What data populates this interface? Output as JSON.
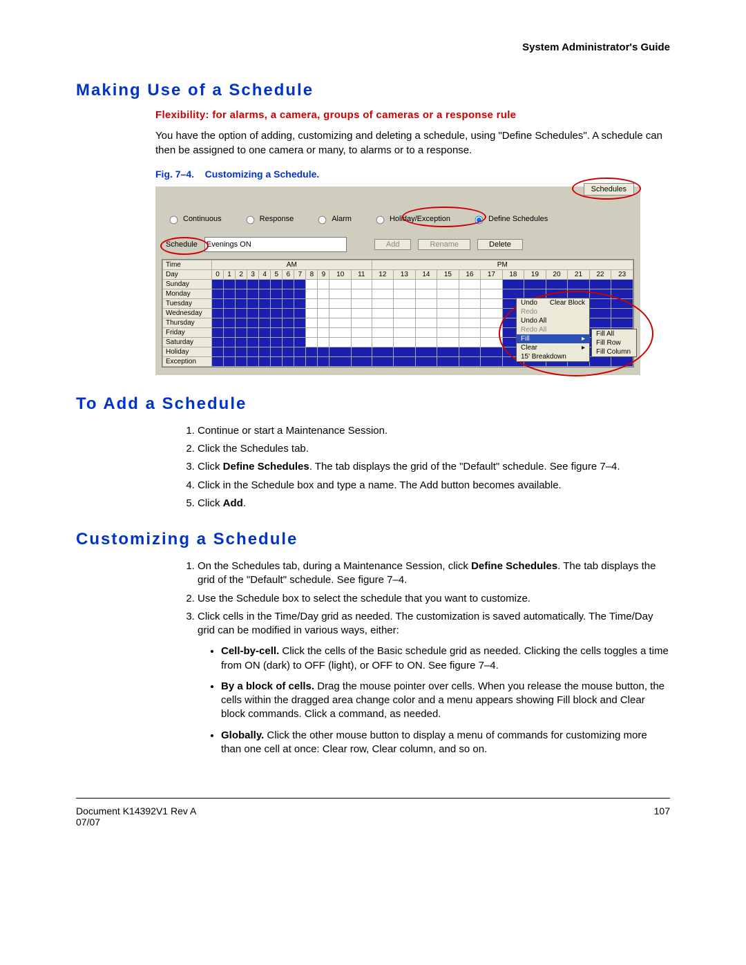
{
  "header": {
    "right": "System Administrator's Guide"
  },
  "h1_making": "Making Use of a Schedule",
  "red_sub": "Flexibility: for alarms, a camera, groups of cameras or a response rule",
  "para_intro": "You have the option of adding, customizing and deleting a schedule, using \"Define Schedules\". A schedule can then be assigned to one  camera or many, to alarms or to a response.",
  "fig_caption_prefix": "Fig. 7–4.",
  "fig_caption_title": "Customizing a Schedule.",
  "fig": {
    "schedules_tab": "Schedules",
    "radios": {
      "continuous": "Continuous",
      "response": "Response",
      "alarm": "Alarm",
      "holiday": "Holiday/Exception",
      "define": "Define Schedules"
    },
    "schedule_label": "Schedule",
    "schedule_value": "Evenings ON",
    "btn_add": "Add",
    "btn_rename": "Rename",
    "btn_delete": "Delete",
    "grid": {
      "time_label": "Time",
      "day_label": "Day",
      "am_label": "AM",
      "pm_label": "PM",
      "hours": [
        "0",
        "1",
        "2",
        "3",
        "4",
        "5",
        "6",
        "7",
        "8",
        "9",
        "10",
        "11",
        "12",
        "13",
        "14",
        "15",
        "16",
        "17",
        "18",
        "19",
        "20",
        "21",
        "22",
        "23"
      ],
      "days": [
        "Sunday",
        "Monday",
        "Tuesday",
        "Wednesday",
        "Thursday",
        "Friday",
        "Saturday",
        "Holiday",
        "Exception"
      ]
    },
    "ctx": {
      "undo": "Undo",
      "redo": "Redo",
      "undo_all": "Undo All",
      "redo_all": "Redo All",
      "fill": "Fill",
      "clear": "Clear",
      "breakdown": "15' Breakdown",
      "clear_block": "Clear Block",
      "fill_all": "Fill All",
      "fill_row": "Fill Row",
      "fill_column": "Fill Column"
    }
  },
  "h1_add": "To Add a Schedule",
  "add_steps": {
    "s1": "Continue or start a Maintenance Session.",
    "s2": "Click the Schedules tab.",
    "s3a": "Click ",
    "s3b": "Define Schedules",
    "s3c": ". The tab displays the grid of the \"Default\" schedule. See figure 7–4.",
    "s4": "Click in the Schedule box and type a name. The Add button becomes available.",
    "s5a": "Click ",
    "s5b": "Add",
    "s5c": "."
  },
  "h1_custom": "Customizing a Schedule",
  "cust_steps": {
    "s1a": "On the Schedules tab, during a Maintenance Session, click ",
    "s1b": "Define Schedules",
    "s1c": ". The tab displays the grid of the \"Default\" schedule. See figure 7–4.",
    "s2": "Use the Schedule box to select the schedule that you want to customize.",
    "s3": "Click cells in the Time/Day grid as needed. The customization is saved automatically. The Time/Day grid can be modified in various ways, either:",
    "b1a": "Cell-by-cell.",
    "b1b": " Click the cells of the Basic schedule grid as needed. Clicking the cells toggles a time from ON (dark) to OFF (light), or OFF to ON. See figure 7–4.",
    "b2a": "By a block of cells.",
    "b2b": " Drag the mouse pointer over cells. When you release the mouse button, the cells within the dragged area change color and a menu appears showing Fill block and Clear block commands. Click a command, as needed.",
    "b3a": "Globally.",
    "b3b": " Click the other mouse button to display a menu of commands for customizing more than one cell at once: Clear row, Clear column, and so on."
  },
  "footer": {
    "left1": "Document K14392V1 Rev A",
    "left2": "07/07",
    "page": "107"
  },
  "chart_data": {
    "type": "table",
    "title": "Evenings ON schedule grid (ON=1, OFF=0)",
    "columns_hours": [
      0,
      1,
      2,
      3,
      4,
      5,
      6,
      7,
      8,
      9,
      10,
      11,
      12,
      13,
      14,
      15,
      16,
      17,
      18,
      19,
      20,
      21,
      22,
      23
    ],
    "rows": [
      {
        "day": "Sunday",
        "cells": [
          1,
          1,
          1,
          1,
          1,
          1,
          1,
          1,
          0,
          0,
          0,
          0,
          0,
          0,
          0,
          0,
          0,
          0,
          1,
          1,
          1,
          1,
          1,
          1
        ]
      },
      {
        "day": "Monday",
        "cells": [
          1,
          1,
          1,
          1,
          1,
          1,
          1,
          1,
          0,
          0,
          0,
          0,
          0,
          0,
          0,
          0,
          0,
          0,
          1,
          1,
          1,
          1,
          1,
          1
        ]
      },
      {
        "day": "Tuesday",
        "cells": [
          1,
          1,
          1,
          1,
          1,
          1,
          1,
          1,
          0,
          0,
          0,
          0,
          0,
          0,
          0,
          0,
          0,
          0,
          1,
          1,
          1,
          1,
          1,
          1
        ]
      },
      {
        "day": "Wednesday",
        "cells": [
          1,
          1,
          1,
          1,
          1,
          1,
          1,
          1,
          0,
          0,
          0,
          0,
          0,
          0,
          0,
          0,
          0,
          0,
          1,
          1,
          1,
          1,
          1,
          1
        ]
      },
      {
        "day": "Thursday",
        "cells": [
          1,
          1,
          1,
          1,
          1,
          1,
          1,
          1,
          0,
          0,
          0,
          0,
          0,
          0,
          0,
          0,
          0,
          0,
          1,
          1,
          1,
          1,
          1,
          1
        ]
      },
      {
        "day": "Friday",
        "cells": [
          1,
          1,
          1,
          1,
          1,
          1,
          1,
          1,
          0,
          0,
          0,
          0,
          0,
          0,
          0,
          0,
          0,
          0,
          1,
          1,
          1,
          1,
          1,
          1
        ]
      },
      {
        "day": "Saturday",
        "cells": [
          1,
          1,
          1,
          1,
          1,
          1,
          1,
          1,
          0,
          0,
          0,
          0,
          0,
          0,
          0,
          0,
          0,
          0,
          1,
          1,
          1,
          1,
          1,
          1
        ]
      },
      {
        "day": "Holiday",
        "cells": [
          1,
          1,
          1,
          1,
          1,
          1,
          1,
          1,
          1,
          1,
          1,
          1,
          1,
          1,
          1,
          1,
          1,
          1,
          1,
          1,
          1,
          1,
          1,
          1
        ]
      },
      {
        "day": "Exception",
        "cells": [
          1,
          1,
          1,
          1,
          1,
          1,
          1,
          1,
          1,
          1,
          1,
          1,
          1,
          1,
          1,
          1,
          1,
          1,
          1,
          1,
          1,
          1,
          1,
          1
        ]
      }
    ]
  }
}
